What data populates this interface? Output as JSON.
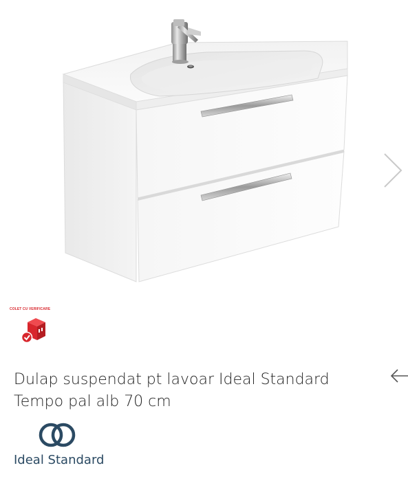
{
  "gallery": {
    "product_image": "bathroom-vanity-cabinet-white-two-drawers",
    "next_icon": "chevron-right-icon",
    "badge": {
      "label": "COLET CU VERIFICARE",
      "icon": "package-check-icon",
      "accent_color": "#d8262c"
    }
  },
  "product": {
    "title": "Dulap suspendat pt lavoar Ideal Standard Tempo pal alb 70 cm",
    "back_icon": "arrow-left-icon"
  },
  "brand": {
    "name": "Ideal Standard",
    "logo_icon": "ideal-standard-logo-icon",
    "color": "#2b4a63"
  }
}
